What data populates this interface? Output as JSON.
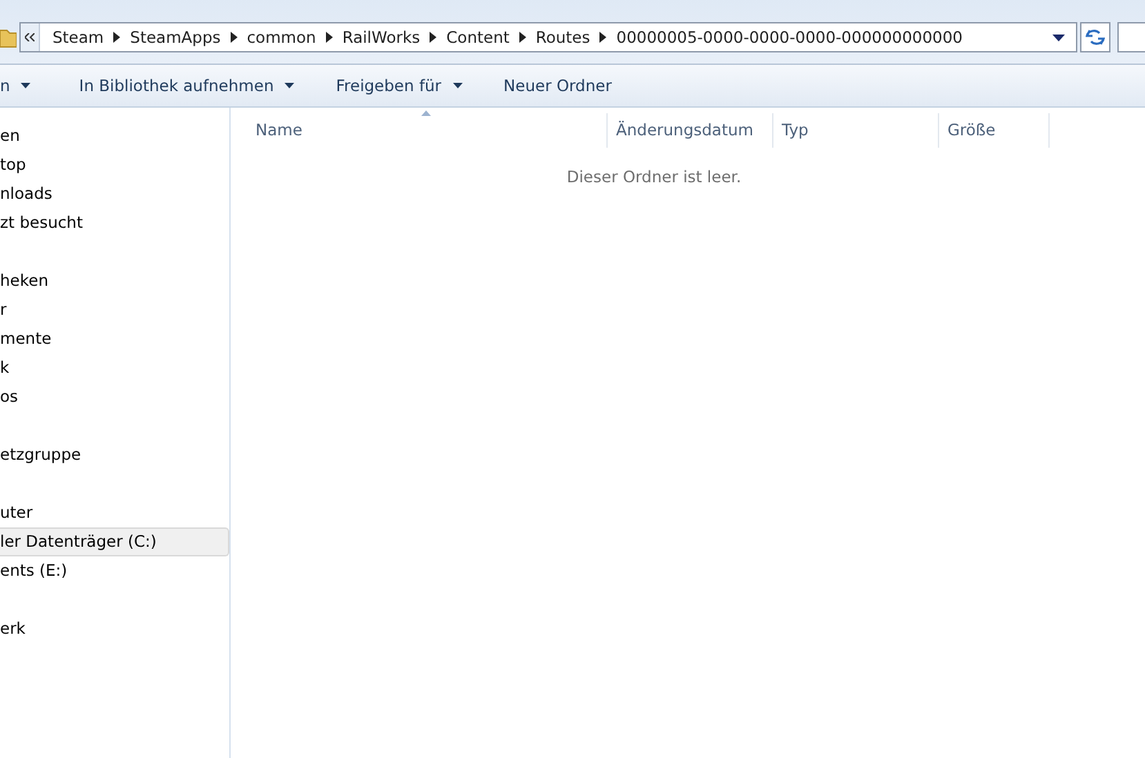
{
  "address_bar": {
    "crumbs": [
      "Steam",
      "SteamApps",
      "common",
      "RailWorks",
      "Content",
      "Routes",
      "00000005-0000-0000-0000-000000000000"
    ]
  },
  "toolbar": [
    {
      "label": "n",
      "dropdown": true
    },
    {
      "label": "In Bibliothek aufnehmen",
      "dropdown": true
    },
    {
      "label": "Freigeben für",
      "dropdown": true
    },
    {
      "label": "Neuer Ordner",
      "dropdown": false
    }
  ],
  "sidebar": {
    "groups": [
      [
        {
          "label": "en",
          "selected": false
        },
        {
          "label": "top",
          "selected": false
        },
        {
          "label": "nloads",
          "selected": false
        },
        {
          "label": "zt besucht",
          "selected": false
        }
      ],
      [
        {
          "label": "heken",
          "selected": false
        },
        {
          "label": "r",
          "selected": false
        },
        {
          "label": "mente",
          "selected": false
        },
        {
          "label": "k",
          "selected": false
        },
        {
          "label": "os",
          "selected": false
        }
      ],
      [
        {
          "label": "etzgruppe",
          "selected": false
        }
      ],
      [
        {
          "label": "uter",
          "selected": false
        },
        {
          "label": "ler Datenträger (C:)",
          "selected": true
        },
        {
          "label": "ents (E:)",
          "selected": false
        }
      ],
      [
        {
          "label": "erk",
          "selected": false
        }
      ]
    ]
  },
  "file_list": {
    "columns": [
      "Name",
      "Änderungsdatum",
      "Typ",
      "Größe"
    ],
    "empty_message": "Dieser Ordner ist leer."
  }
}
